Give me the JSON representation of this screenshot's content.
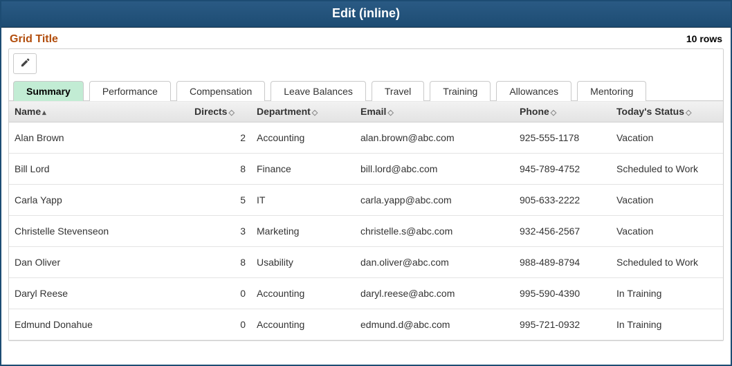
{
  "banner": {
    "title": "Edit (inline)"
  },
  "grid": {
    "title": "Grid Title",
    "row_count_label": "10 rows",
    "tabs": [
      {
        "label": "Summary",
        "active": true
      },
      {
        "label": "Performance",
        "active": false
      },
      {
        "label": "Compensation",
        "active": false
      },
      {
        "label": "Leave Balances",
        "active": false
      },
      {
        "label": "Travel",
        "active": false
      },
      {
        "label": "Training",
        "active": false
      },
      {
        "label": "Allowances",
        "active": false
      },
      {
        "label": "Mentoring",
        "active": false
      }
    ],
    "columns": [
      {
        "key": "name",
        "label": "Name",
        "sort": "asc"
      },
      {
        "key": "directs",
        "label": "Directs",
        "sort": "sortable"
      },
      {
        "key": "dept",
        "label": "Department",
        "sort": "sortable"
      },
      {
        "key": "email",
        "label": "Email",
        "sort": "sortable"
      },
      {
        "key": "phone",
        "label": "Phone",
        "sort": "sortable"
      },
      {
        "key": "status",
        "label": "Today's Status",
        "sort": "sortable"
      }
    ],
    "rows": [
      {
        "name": "Alan Brown",
        "directs": "2",
        "dept": "Accounting",
        "email": "alan.brown@abc.com",
        "phone": "925-555-1178",
        "status": "Vacation"
      },
      {
        "name": "Bill Lord",
        "directs": "8",
        "dept": "Finance",
        "email": "bill.lord@abc.com",
        "phone": "945-789-4752",
        "status": "Scheduled to Work"
      },
      {
        "name": "Carla Yapp",
        "directs": "5",
        "dept": "IT",
        "email": "carla.yapp@abc.com",
        "phone": "905-633-2222",
        "status": "Vacation"
      },
      {
        "name": "Christelle Stevenseon",
        "directs": "3",
        "dept": "Marketing",
        "email": "christelle.s@abc.com",
        "phone": "932-456-2567",
        "status": "Vacation"
      },
      {
        "name": "Dan Oliver",
        "directs": "8",
        "dept": "Usability",
        "email": "dan.oliver@abc.com",
        "phone": "988-489-8794",
        "status": "Scheduled to Work"
      },
      {
        "name": "Daryl Reese",
        "directs": "0",
        "dept": "Accounting",
        "email": "daryl.reese@abc.com",
        "phone": "995-590-4390",
        "status": "In Training"
      },
      {
        "name": "Edmund Donahue",
        "directs": "0",
        "dept": "Accounting",
        "email": "edmund.d@abc.com",
        "phone": "995-721-0932",
        "status": "In Training"
      }
    ]
  }
}
